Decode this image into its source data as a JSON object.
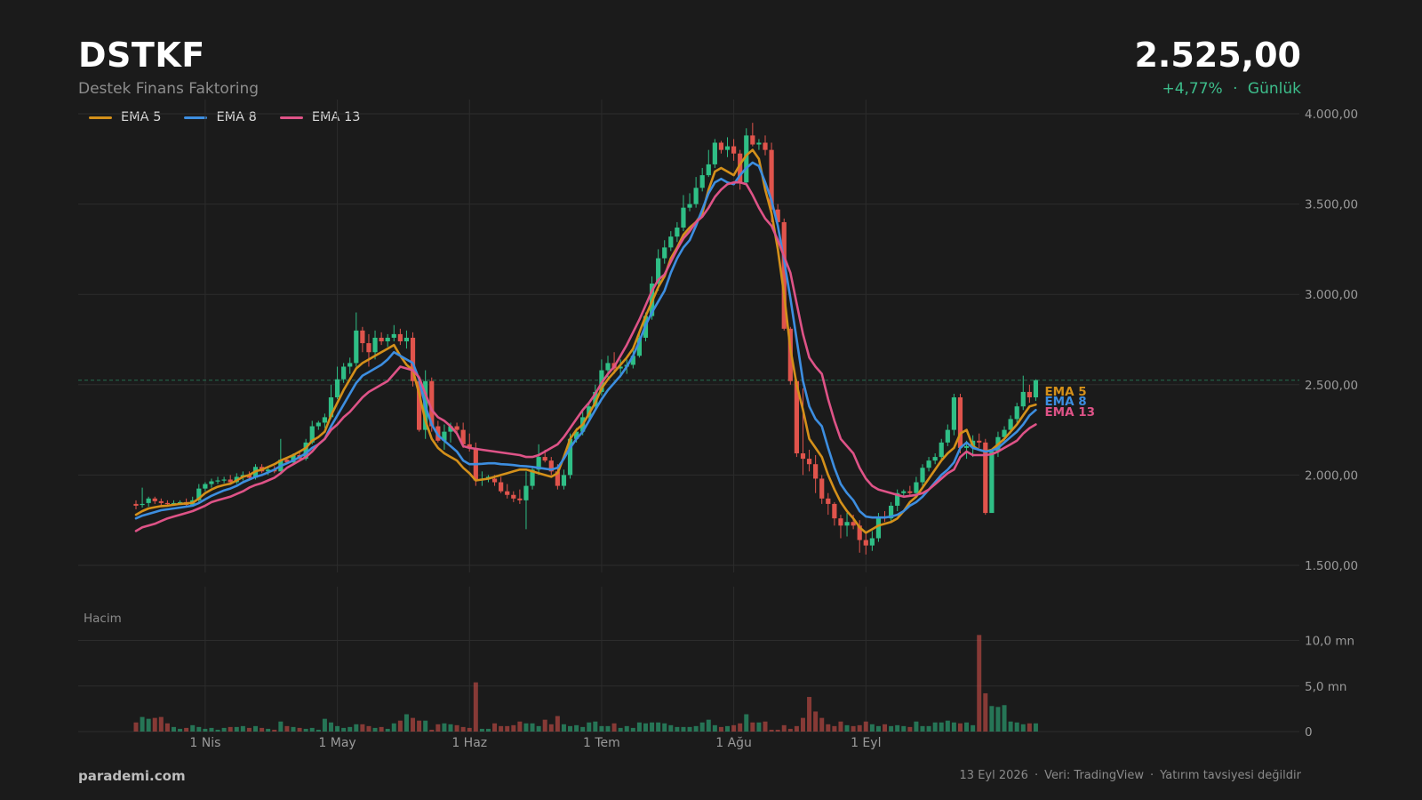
{
  "header": {
    "ticker": "DSTKF",
    "company": "Destek Finans Faktoring",
    "price": "2.525,00",
    "change": "+4,77%",
    "change_separator": "·",
    "period": "Günlük"
  },
  "footer": {
    "brand": "parademi.com",
    "date": "13 Eyl 2026",
    "source": "Veri: TradingView",
    "disclaimer": "Yatırım tavsiyesi değildir",
    "separator": "·"
  },
  "colors": {
    "background": "#1b1b1b",
    "up": "#2fbf86",
    "down": "#e0544c",
    "ema5": "#d4901a",
    "ema8": "#3d8ee0",
    "ema13": "#de5387",
    "grid": "#2c2c2c",
    "axis_text": "#9a9a9a",
    "last_price_line": "#2fbf86"
  },
  "chart_data": {
    "type": "candlestick",
    "price_axis": {
      "ylim": [
        1500,
        4000
      ],
      "ticks": [
        1500,
        2000,
        2500,
        3000,
        3500,
        4000
      ],
      "tick_labels": [
        "1.500,00",
        "2.000,00",
        "2.500,00",
        "3.000,00",
        "3.500,00",
        "4.000,00"
      ]
    },
    "volume_axis": {
      "label": "Hacim",
      "ylim": [
        0,
        12
      ],
      "ticks": [
        0,
        5,
        10
      ],
      "tick_labels": [
        "0",
        "5,0 mn",
        "10,0 mn"
      ]
    },
    "x_axis": {
      "labels": [
        "1 Nis",
        "1 May",
        "1 Haz",
        "1 Tem",
        "1 Ağu",
        "1 Eyl"
      ],
      "label_indices": [
        11,
        32,
        53,
        74,
        95,
        116
      ]
    },
    "last_price": 2525,
    "series_legend": [
      "EMA 5",
      "EMA 8",
      "EMA 13"
    ],
    "candles": [
      [
        1840,
        1860,
        1810,
        1830,
        1.0
      ],
      [
        1835,
        1930,
        1820,
        1840,
        1.6
      ],
      [
        1845,
        1880,
        1825,
        1870,
        1.4
      ],
      [
        1870,
        1880,
        1840,
        1855,
        1.5
      ],
      [
        1855,
        1870,
        1830,
        1845,
        1.6
      ],
      [
        1845,
        1860,
        1825,
        1840,
        0.9
      ],
      [
        1840,
        1860,
        1830,
        1845,
        0.5
      ],
      [
        1845,
        1860,
        1840,
        1850,
        0.3
      ],
      [
        1850,
        1870,
        1820,
        1835,
        0.4
      ],
      [
        1835,
        1880,
        1830,
        1860,
        0.7
      ],
      [
        1860,
        1950,
        1850,
        1925,
        0.5
      ],
      [
        1925,
        1960,
        1910,
        1950,
        0.3
      ],
      [
        1950,
        1980,
        1930,
        1965,
        0.4
      ],
      [
        1965,
        1990,
        1950,
        1970,
        0.2
      ],
      [
        1970,
        1990,
        1955,
        1975,
        0.4
      ],
      [
        1975,
        2000,
        1950,
        1960,
        0.5
      ],
      [
        1960,
        2010,
        1950,
        1990,
        0.5
      ],
      [
        1990,
        2020,
        1970,
        2000,
        0.6
      ],
      [
        2000,
        2020,
        1970,
        1985,
        0.4
      ],
      [
        1985,
        2060,
        1975,
        2045,
        0.6
      ],
      [
        2045,
        2060,
        2010,
        2020,
        0.4
      ],
      [
        2020,
        2040,
        2000,
        2030,
        0.3
      ],
      [
        2030,
        2050,
        2010,
        2020,
        0.2
      ],
      [
        2020,
        2200,
        2020,
        2085,
        1.1
      ],
      [
        2085,
        2100,
        2060,
        2070,
        0.6
      ],
      [
        2070,
        2120,
        2060,
        2110,
        0.5
      ],
      [
        2110,
        2130,
        2080,
        2090,
        0.4
      ],
      [
        2090,
        2200,
        2080,
        2180,
        0.3
      ],
      [
        2180,
        2300,
        2170,
        2270,
        0.4
      ],
      [
        2270,
        2300,
        2250,
        2290,
        0.2
      ],
      [
        2290,
        2340,
        2260,
        2320,
        1.4
      ],
      [
        2320,
        2500,
        2310,
        2430,
        1.0
      ],
      [
        2430,
        2600,
        2420,
        2530,
        0.6
      ],
      [
        2530,
        2620,
        2510,
        2600,
        0.4
      ],
      [
        2600,
        2650,
        2560,
        2620,
        0.5
      ],
      [
        2620,
        2900,
        2600,
        2800,
        0.8
      ],
      [
        2800,
        2820,
        2680,
        2730,
        0.8
      ],
      [
        2730,
        2780,
        2600,
        2680,
        0.6
      ],
      [
        2680,
        2800,
        2640,
        2760,
        0.4
      ],
      [
        2760,
        2790,
        2720,
        2740,
        0.5
      ],
      [
        2740,
        2780,
        2710,
        2760,
        0.3
      ],
      [
        2760,
        2830,
        2740,
        2780,
        0.9
      ],
      [
        2780,
        2810,
        2720,
        2740,
        1.2
      ],
      [
        2740,
        2800,
        2700,
        2760,
        1.9
      ],
      [
        2760,
        2790,
        2490,
        2520,
        1.5
      ],
      [
        2520,
        2550,
        2240,
        2250,
        1.2
      ],
      [
        2250,
        2580,
        2200,
        2520,
        1.2
      ],
      [
        2520,
        2540,
        2240,
        2270,
        0.2
      ],
      [
        2270,
        2300,
        2180,
        2190,
        0.8
      ],
      [
        2190,
        2280,
        2140,
        2240,
        0.9
      ],
      [
        2240,
        2290,
        2180,
        2270,
        0.8
      ],
      [
        2270,
        2290,
        2220,
        2250,
        0.7
      ],
      [
        2250,
        2290,
        2150,
        2170,
        0.5
      ],
      [
        2170,
        2230,
        2130,
        2150,
        0.4
      ],
      [
        2150,
        2180,
        1940,
        1970,
        5.4
      ],
      [
        1970,
        2020,
        1940,
        1980,
        0.3
      ],
      [
        1980,
        2000,
        1960,
        1990,
        0.3
      ],
      [
        1980,
        2000,
        1940,
        1960,
        0.9
      ],
      [
        1960,
        1990,
        1900,
        1910,
        0.6
      ],
      [
        1910,
        1950,
        1870,
        1890,
        0.6
      ],
      [
        1890,
        1910,
        1850,
        1870,
        0.7
      ],
      [
        1870,
        1920,
        1840,
        1860,
        1.1
      ],
      [
        1860,
        2020,
        1700,
        1940,
        0.9
      ],
      [
        1940,
        2050,
        1920,
        2030,
        0.9
      ],
      [
        2030,
        2170,
        2000,
        2100,
        0.6
      ],
      [
        2100,
        2140,
        2070,
        2080,
        1.3
      ],
      [
        2080,
        2100,
        2000,
        2020,
        0.8
      ],
      [
        2020,
        2060,
        1920,
        1940,
        1.7
      ],
      [
        1940,
        2030,
        1920,
        2000,
        0.8
      ],
      [
        2000,
        2230,
        1980,
        2200,
        0.6
      ],
      [
        2200,
        2260,
        2180,
        2240,
        0.7
      ],
      [
        2240,
        2350,
        2220,
        2320,
        0.5
      ],
      [
        2320,
        2400,
        2300,
        2380,
        1.0
      ],
      [
        2380,
        2500,
        2360,
        2460,
        1.1
      ],
      [
        2460,
        2640,
        2440,
        2580,
        0.6
      ],
      [
        2580,
        2660,
        2540,
        2620,
        0.6
      ],
      [
        2620,
        2680,
        2560,
        2590,
        0.9
      ],
      [
        2590,
        2640,
        2540,
        2600,
        0.4
      ],
      [
        2600,
        2640,
        2560,
        2610,
        0.6
      ],
      [
        2610,
        2700,
        2590,
        2660,
        0.4
      ],
      [
        2660,
        2800,
        2650,
        2760,
        1.0
      ],
      [
        2760,
        2900,
        2740,
        2880,
        0.9
      ],
      [
        2880,
        3100,
        2860,
        3060,
        1.0
      ],
      [
        3060,
        3250,
        3020,
        3200,
        1.0
      ],
      [
        3200,
        3300,
        3170,
        3260,
        0.9
      ],
      [
        3260,
        3350,
        3240,
        3320,
        0.7
      ],
      [
        3320,
        3400,
        3290,
        3370,
        0.5
      ],
      [
        3370,
        3550,
        3350,
        3480,
        0.5
      ],
      [
        3480,
        3560,
        3460,
        3500,
        0.5
      ],
      [
        3500,
        3650,
        3480,
        3590,
        0.6
      ],
      [
        3590,
        3700,
        3570,
        3660,
        1.0
      ],
      [
        3660,
        3800,
        3650,
        3720,
        1.3
      ],
      [
        3720,
        3860,
        3700,
        3840,
        0.7
      ],
      [
        3840,
        3850,
        3780,
        3800,
        0.5
      ],
      [
        3800,
        3870,
        3760,
        3820,
        0.6
      ],
      [
        3820,
        3860,
        3740,
        3780,
        0.7
      ],
      [
        3780,
        3800,
        3580,
        3620,
        0.9
      ],
      [
        3620,
        3920,
        3600,
        3880,
        1.9
      ],
      [
        3880,
        3950,
        3820,
        3830,
        1.0
      ],
      [
        3830,
        3860,
        3800,
        3840,
        1.0
      ],
      [
        3840,
        3880,
        3770,
        3800,
        1.1
      ],
      [
        3800,
        3840,
        3400,
        3470,
        0.2
      ],
      [
        3470,
        3500,
        3380,
        3400,
        0.2
      ],
      [
        3400,
        3420,
        2800,
        2810,
        0.7
      ],
      [
        2810,
        2820,
        2500,
        2520,
        0.3
      ],
      [
        2520,
        2530,
        2100,
        2120,
        0.6
      ],
      [
        2120,
        2480,
        2000,
        2090,
        1.5
      ],
      [
        2090,
        2140,
        2020,
        2060,
        3.8
      ],
      [
        2060,
        2110,
        1900,
        1980,
        2.2
      ],
      [
        1980,
        2000,
        1840,
        1870,
        1.5
      ],
      [
        1870,
        1900,
        1780,
        1840,
        0.8
      ],
      [
        1840,
        1850,
        1720,
        1760,
        0.6
      ],
      [
        1760,
        1780,
        1650,
        1720,
        1.1
      ],
      [
        1720,
        1790,
        1660,
        1740,
        0.7
      ],
      [
        1740,
        1780,
        1700,
        1720,
        0.6
      ],
      [
        1720,
        1750,
        1570,
        1640,
        0.7
      ],
      [
        1640,
        1680,
        1560,
        1610,
        1.1
      ],
      [
        1610,
        1690,
        1580,
        1650,
        0.8
      ],
      [
        1650,
        1790,
        1630,
        1770,
        0.6
      ],
      [
        1770,
        1800,
        1740,
        1760,
        0.8
      ],
      [
        1760,
        1850,
        1740,
        1830,
        0.6
      ],
      [
        1830,
        1920,
        1800,
        1900,
        0.7
      ],
      [
        1900,
        1920,
        1880,
        1910,
        0.6
      ],
      [
        1910,
        1940,
        1890,
        1900,
        0.5
      ],
      [
        1900,
        1990,
        1880,
        1960,
        1.1
      ],
      [
        1960,
        2060,
        1940,
        2040,
        0.6
      ],
      [
        2040,
        2100,
        2020,
        2080,
        0.6
      ],
      [
        2080,
        2120,
        2060,
        2100,
        1.0
      ],
      [
        2100,
        2200,
        2080,
        2180,
        1.0
      ],
      [
        2180,
        2280,
        2160,
        2250,
        1.2
      ],
      [
        2250,
        2450,
        2220,
        2430,
        1.0
      ],
      [
        2430,
        2450,
        2120,
        2150,
        0.9
      ],
      [
        2150,
        2190,
        2090,
        2160,
        1.0
      ],
      [
        2160,
        2220,
        2100,
        2190,
        0.7
      ],
      [
        2190,
        2230,
        2150,
        2180,
        10.6
      ],
      [
        2180,
        2200,
        1780,
        1790,
        4.2
      ],
      [
        1790,
        2140,
        1880,
        2130,
        2.8
      ],
      [
        2130,
        2240,
        2100,
        2210,
        2.7
      ],
      [
        2210,
        2270,
        2180,
        2250,
        2.9
      ],
      [
        2250,
        2330,
        2230,
        2310,
        1.1
      ],
      [
        2310,
        2400,
        2290,
        2380,
        1.0
      ],
      [
        2380,
        2550,
        2360,
        2460,
        0.8
      ],
      [
        2460,
        2500,
        2400,
        2430,
        0.9
      ],
      [
        2430,
        2530,
        2410,
        2525,
        0.9
      ]
    ],
    "ema5": [
      1780,
      1800,
      1815,
      1822,
      1828,
      1830,
      1835,
      1840,
      1843,
      1846,
      1870,
      1900,
      1920,
      1935,
      1945,
      1952,
      1970,
      1990,
      2000,
      2020,
      2030,
      2045,
      2060,
      2080,
      2095,
      2110,
      2130,
      2150,
      2190,
      2210,
      2240,
      2330,
      2400,
      2470,
      2530,
      2590,
      2620,
      2640,
      2660,
      2680,
      2700,
      2720,
      2660,
      2610,
      2580,
      2450,
      2300,
      2200,
      2150,
      2120,
      2100,
      2080,
      2040,
      2010,
      1970,
      1975,
      1980,
      1990,
      2000,
      2010,
      2020,
      2030,
      2030,
      2020,
      2010,
      2000,
      1990,
      2010,
      2100,
      2200,
      2250,
      2280,
      2340,
      2400,
      2480,
      2530,
      2570,
      2610,
      2650,
      2700,
      2790,
      2880,
      2960,
      3040,
      3100,
      3200,
      3260,
      3330,
      3370,
      3400,
      3450,
      3580,
      3680,
      3700,
      3680,
      3660,
      3720,
      3770,
      3800,
      3750,
      3580,
      3450,
      3250,
      3000,
      2700,
      2500,
      2360,
      2200,
      2150,
      2100,
      2000,
      1920,
      1850,
      1800,
      1760,
      1710,
      1680,
      1700,
      1720,
      1730,
      1740,
      1760,
      1800,
      1850,
      1880,
      1930,
      1980,
      2030,
      2080,
      2120,
      2150,
      2230,
      2250,
      2160,
      2140,
      2130,
      2140,
      2170,
      2200,
      2240,
      2280,
      2330,
      2380,
      2390
    ],
    "ema8": [
      1760,
      1775,
      1785,
      1795,
      1805,
      1810,
      1815,
      1820,
      1825,
      1830,
      1845,
      1865,
      1885,
      1900,
      1915,
      1925,
      1940,
      1960,
      1975,
      1990,
      2000,
      2015,
      2030,
      2050,
      2065,
      2080,
      2100,
      2120,
      2150,
      2170,
      2200,
      2270,
      2330,
      2390,
      2450,
      2510,
      2550,
      2570,
      2590,
      2610,
      2640,
      2680,
      2660,
      2640,
      2620,
      2530,
      2380,
      2280,
      2220,
      2190,
      2160,
      2130,
      2080,
      2060,
      2060,
      2062,
      2065,
      2065,
      2060,
      2058,
      2055,
      2050,
      2048,
      2045,
      2040,
      2035,
      2030,
      2040,
      2090,
      2150,
      2200,
      2240,
      2300,
      2360,
      2420,
      2470,
      2510,
      2550,
      2600,
      2660,
      2740,
      2830,
      2900,
      2960,
      3020,
      3120,
      3200,
      3260,
      3300,
      3380,
      3470,
      3560,
      3620,
      3640,
      3620,
      3610,
      3660,
      3700,
      3730,
      3710,
      3620,
      3520,
      3380,
      3190,
      2980,
      2750,
      2520,
      2380,
      2310,
      2270,
      2150,
      2040,
      1950,
      1900,
      1860,
      1800,
      1770,
      1765,
      1765,
      1765,
      1770,
      1780,
      1800,
      1830,
      1850,
      1880,
      1920,
      1960,
      2000,
      2030,
      2070,
      2150,
      2180,
      2150,
      2140,
      2130,
      2135,
      2150,
      2180,
      2210,
      2240,
      2280,
      2330,
      2360
    ],
    "ema13": [
      1690,
      1710,
      1720,
      1730,
      1745,
      1760,
      1770,
      1780,
      1790,
      1800,
      1815,
      1830,
      1850,
      1860,
      1870,
      1880,
      1895,
      1910,
      1930,
      1945,
      1955,
      1970,
      1985,
      2010,
      2040,
      2060,
      2080,
      2100,
      2130,
      2170,
      2200,
      2250,
      2280,
      2320,
      2350,
      2390,
      2430,
      2460,
      2480,
      2500,
      2520,
      2560,
      2600,
      2590,
      2580,
      2540,
      2450,
      2360,
      2320,
      2300,
      2270,
      2230,
      2160,
      2150,
      2145,
      2140,
      2135,
      2130,
      2125,
      2120,
      2115,
      2110,
      2100,
      2100,
      2110,
      2130,
      2150,
      2170,
      2210,
      2260,
      2310,
      2360,
      2400,
      2450,
      2510,
      2560,
      2600,
      2660,
      2720,
      2790,
      2860,
      2940,
      3020,
      3080,
      3110,
      3180,
      3250,
      3310,
      3350,
      3400,
      3430,
      3480,
      3540,
      3580,
      3610,
      3620,
      3620,
      3610,
      3550,
      3480,
      3420,
      3380,
      3300,
      3210,
      3120,
      2950,
      2780,
      2650,
      2600,
      2560,
      2420,
      2300,
      2200,
      2160,
      2120,
      2040,
      1980,
      1940,
      1920,
      1910,
      1900,
      1890,
      1880,
      1885,
      1890,
      1900,
      1920,
      1950,
      1980,
      2010,
      2030,
      2100,
      2130,
      2110,
      2110,
      2110,
      2115,
      2130,
      2150,
      2170,
      2190,
      2230,
      2260,
      2280
    ]
  }
}
